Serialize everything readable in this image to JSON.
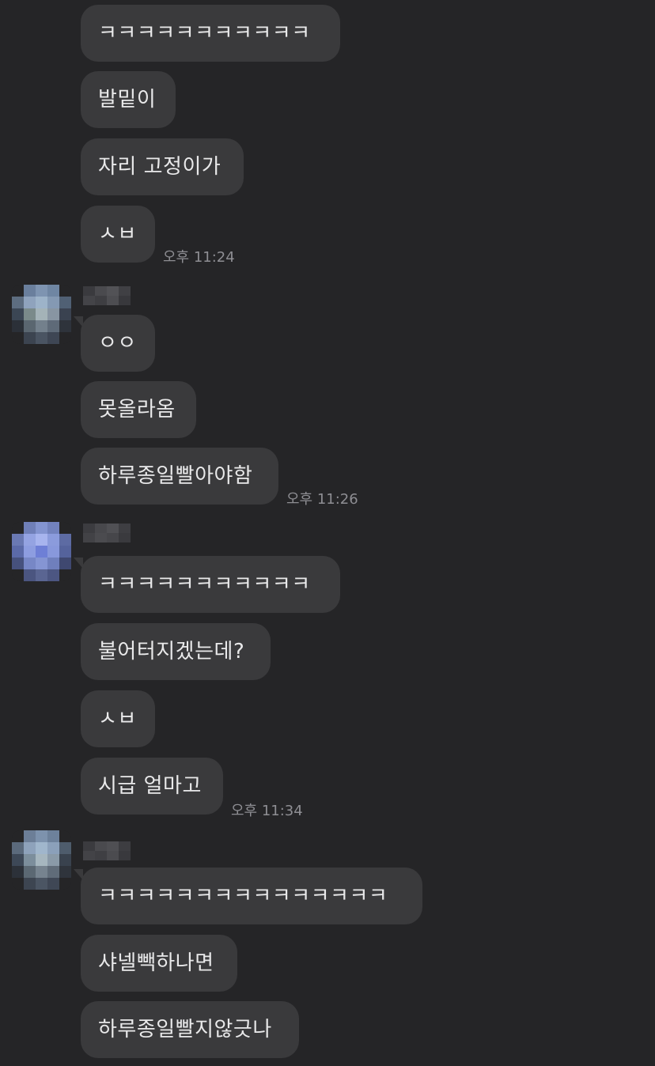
{
  "messages": [
    {
      "text": "ㅋㅋㅋㅋㅋㅋㅋㅋㅋㅋㅋ"
    },
    {
      "text": "발밑이"
    },
    {
      "text": "자리 고정이가"
    },
    {
      "text": "ㅅㅂ",
      "time": "오후 11:24"
    },
    {
      "text": "ㅇㅇ"
    },
    {
      "text": "못올라옴"
    },
    {
      "text": "하루종일빨아야함",
      "time": "오후 11:26"
    },
    {
      "text": "ㅋㅋㅋㅋㅋㅋㅋㅋㅋㅋㅋ"
    },
    {
      "text": "불어터지겠는데?"
    },
    {
      "text": "ㅅㅂ"
    },
    {
      "text": "시급 얼마고",
      "time": "오후 11:34"
    },
    {
      "text": "ㅋㅋㅋㅋㅋㅋㅋㅋㅋㅋㅋㅋㅋㅋㅋ"
    },
    {
      "text": "샤넬빽하나면"
    },
    {
      "text": "하루종일빨지않긋나"
    }
  ],
  "colors": {
    "background": "#252527",
    "bubble": "#3a3a3c",
    "text": "#e9e9ea",
    "timestamp": "#8e8e93"
  }
}
